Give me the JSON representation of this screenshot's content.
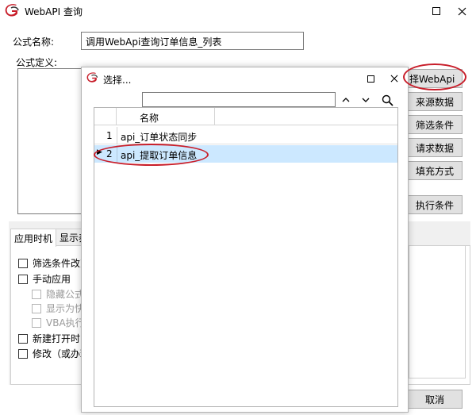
{
  "window": {
    "title": "WebAPI 查询",
    "maximize_icon": "square-icon",
    "close_icon": "x-icon"
  },
  "form": {
    "formula_name_label": "公式名称:",
    "formula_name_value": "调用WebApi查询订单信息_列表",
    "formula_def_label": "公式定义:"
  },
  "right_buttons": [
    "择WebApi",
    "来源数据",
    "筛选条件",
    "请求数据",
    "填充方式",
    "执行条件"
  ],
  "cancel_label": "取消",
  "tabs": [
    "应用时机",
    "显示养"
  ],
  "checkboxes": [
    {
      "label": "筛选条件改变",
      "enabled": true
    },
    {
      "label": "手动应用",
      "enabled": true
    },
    {
      "label": "隐藏公式",
      "enabled": false
    },
    {
      "label": "显示为快",
      "enabled": false
    },
    {
      "label": "VBA执行",
      "enabled": false
    },
    {
      "label": "新建打开时",
      "enabled": true
    },
    {
      "label": "修改（或办理",
      "enabled": true
    }
  ],
  "dialog": {
    "title": "选择...",
    "search_value": "",
    "column_header": "名称",
    "rows": [
      {
        "index": "1",
        "name": "api_订单状态同步"
      },
      {
        "index": "2",
        "name": "api_提取订单信息"
      }
    ],
    "selected_row": 1
  },
  "colors": {
    "accent_red": "#c81e2a",
    "selected_row": "#cce8ff",
    "dialog_border": "#b4b4b4"
  }
}
